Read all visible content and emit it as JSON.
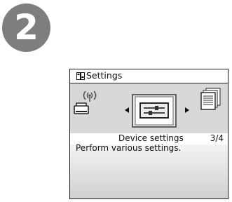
{
  "step": {
    "number": "2"
  },
  "screen": {
    "title": "Settings",
    "menu": {
      "selected_label": "Device settings",
      "page_indicator": "3/4",
      "description": "Perform various settings."
    },
    "icons": {
      "header": "settings-icon",
      "left": "printer-wireless-icon",
      "selected": "device-settings-sliders-icon",
      "right": "documents-icon"
    },
    "colors": {
      "badge": "#7e7e7e",
      "arc": "#d8d8d8",
      "border": "#1a1a1a"
    }
  }
}
